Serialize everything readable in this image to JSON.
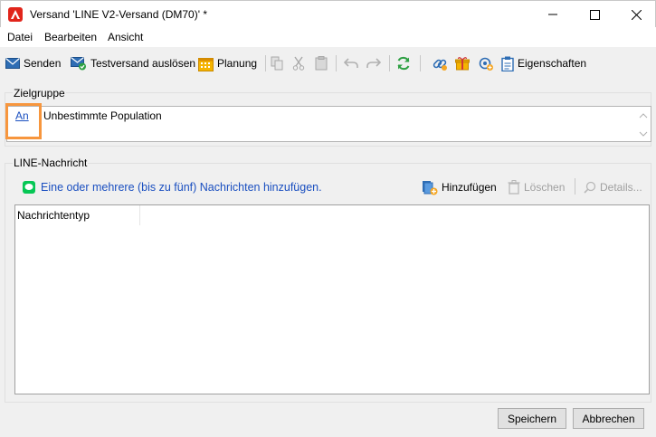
{
  "window": {
    "title": "Versand 'LINE V2-Versand (DM70)' *",
    "controls": {
      "minimize": "minimize-icon",
      "maximize": "maximize-icon",
      "close": "close-icon"
    }
  },
  "menu": [
    "Datei",
    "Bearbeiten",
    "Ansicht"
  ],
  "toolbar": {
    "send": "Senden",
    "proof": "Testversand auslösen",
    "schedule": "Planung",
    "properties": "Eigenschaften"
  },
  "target": {
    "group_label": "Zielgruppe",
    "link": "An",
    "value": "Unbestimmte Population"
  },
  "line_message": {
    "group_label": "LINE-Nachricht",
    "hint": "Eine oder mehrere (bis zu fünf) Nachrichten hinzufügen.",
    "add": "Hinzufügen",
    "delete": "Löschen",
    "details": "Details...",
    "column": "Nachrichtentyp"
  },
  "footer": {
    "save": "Speichern",
    "cancel": "Abbrechen"
  },
  "colors": {
    "accent_link": "#1a4fc0",
    "highlight": "#f7963d",
    "logo": "#e1251b"
  }
}
